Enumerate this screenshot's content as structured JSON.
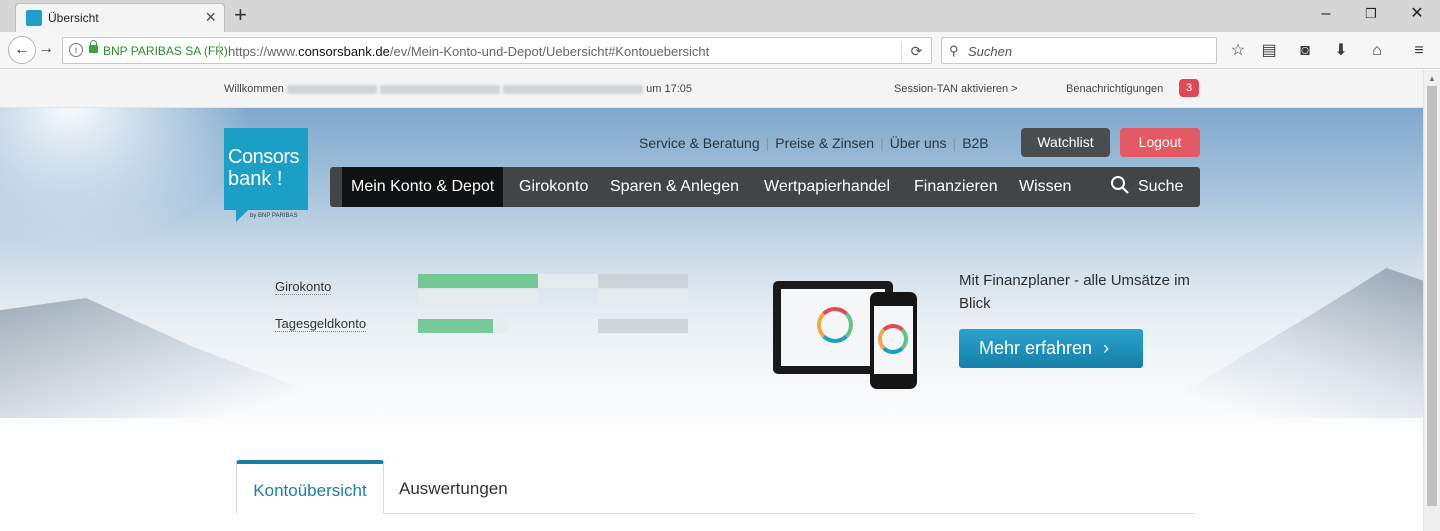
{
  "browser": {
    "tab_title": "Übersicht",
    "url_org": "BNP PARIBAS SA (FR)",
    "url_prefix": "https://www.",
    "url_domain": "consorsbank.de",
    "url_path": "/ev/Mein-Konto-und-Depot/Uebersicht#Kontouebersicht",
    "search_placeholder": "Suchen"
  },
  "topstrip": {
    "welcome_prefix": "Willkommen",
    "welcome_suffix": "um 17:05",
    "session_tan": "Session-TAN aktivieren >",
    "notifications_label": "Benachrichtigungen",
    "notifications_count": "3"
  },
  "logo": {
    "line1": "Consors",
    "line2": "bank !",
    "sub": "by BNP PARIBAS"
  },
  "toplinks": [
    "Service & Beratung",
    "Preise & Zinsen",
    "Über uns",
    "B2B"
  ],
  "buttons": {
    "watchlist": "Watchlist",
    "logout": "Logout"
  },
  "mainnav": {
    "items": [
      "Mein Konto & Depot",
      "Girokonto",
      "Sparen & Anlegen",
      "Wertpapierhandel",
      "Finanzieren",
      "Wissen"
    ],
    "search": "Suche"
  },
  "accounts": [
    {
      "label": "Girokonto"
    },
    {
      "label": "Tagesgeldkonto"
    }
  ],
  "promo": {
    "text": "Mit Finanzplaner - alle Umsätze im Blick",
    "button": "Mehr erfahren"
  },
  "tabs": [
    "Kontoübersicht",
    "Auswertungen"
  ],
  "colors": {
    "brand": "#1b9fc6",
    "logout": "#e45a64",
    "nav": "#424446",
    "tab_active": "#1b7fa3"
  }
}
